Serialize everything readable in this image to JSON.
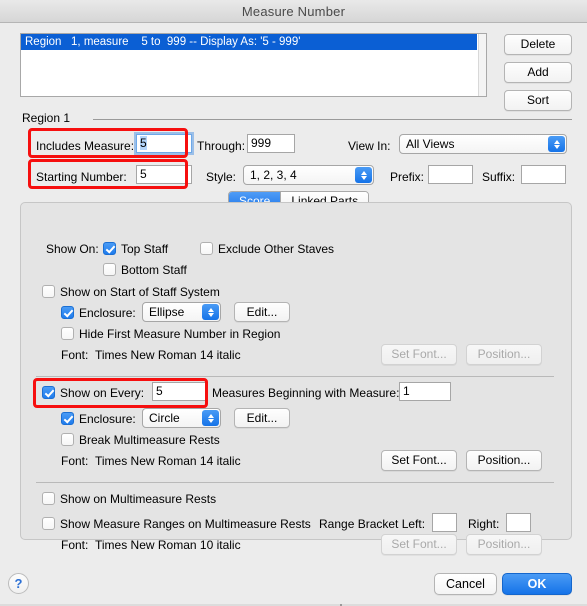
{
  "window": {
    "title": "Measure Number"
  },
  "region_list": {
    "rows": [
      "Region   1, measure    5 to  999 -- Display As: '5 - 999'"
    ]
  },
  "list_buttons": {
    "delete": "Delete",
    "add": "Add",
    "sort": "Sort"
  },
  "region": {
    "header": "Region 1",
    "includes_measure_label": "Includes Measure:",
    "includes_measure_value": "5",
    "through_label": "Through:",
    "through_value": "999",
    "view_in_label": "View In:",
    "view_in_value": "All Views",
    "starting_number_label": "Starting Number:",
    "starting_number_value": "5",
    "style_label": "Style:",
    "style_value": "1, 2, 3, 4",
    "prefix_label": "Prefix:",
    "prefix_value": "",
    "suffix_label": "Suffix:",
    "suffix_value": ""
  },
  "tabs": {
    "score": "Score",
    "linked_parts": "Linked Parts"
  },
  "show_on": {
    "label": "Show On:",
    "top_staff": "Top Staff",
    "exclude_other_staves": "Exclude Other Staves",
    "bottom_staff": "Bottom Staff"
  },
  "start_of_system": {
    "title": "Show on Start of Staff System",
    "enclosure_label": "Enclosure:",
    "enclosure_value": "Ellipse",
    "edit_button": "Edit...",
    "hide_first": "Hide First Measure Number in Region",
    "font_label": "Font:",
    "font_value": "Times New Roman 14 italic",
    "set_font_button": "Set Font...",
    "position_button": "Position..."
  },
  "show_every": {
    "title": "Show on Every:",
    "every_value": "5",
    "beginning_label": "Measures Beginning with Measure:",
    "beginning_value": "1",
    "enclosure_label": "Enclosure:",
    "enclosure_value": "Circle",
    "edit_button": "Edit...",
    "break_multimeasure": "Break Multimeasure Rests",
    "font_label": "Font:",
    "font_value": "Times New Roman 14 italic",
    "set_font_button": "Set Font...",
    "position_button": "Position..."
  },
  "multimeasure": {
    "show_on_rests": "Show on Multimeasure Rests",
    "show_ranges": "Show Measure Ranges on Multimeasure Rests",
    "bracket_left_label": "Range Bracket Left:",
    "bracket_left_value": "",
    "bracket_right_label": "Right:",
    "bracket_right_value": "",
    "font_label": "Font:",
    "font_value": "Times New Roman 10 italic",
    "set_font_button": "Set Font...",
    "position_button": "Position..."
  },
  "footer": {
    "help": "?",
    "cancel": "Cancel",
    "ok": "OK"
  },
  "colors": {
    "accent": "#1573e8",
    "selection": "#0b5fd4",
    "annotation": "#f60f0f",
    "window_bg": "#ececec",
    "panel_bg": "#e4e4e4"
  }
}
